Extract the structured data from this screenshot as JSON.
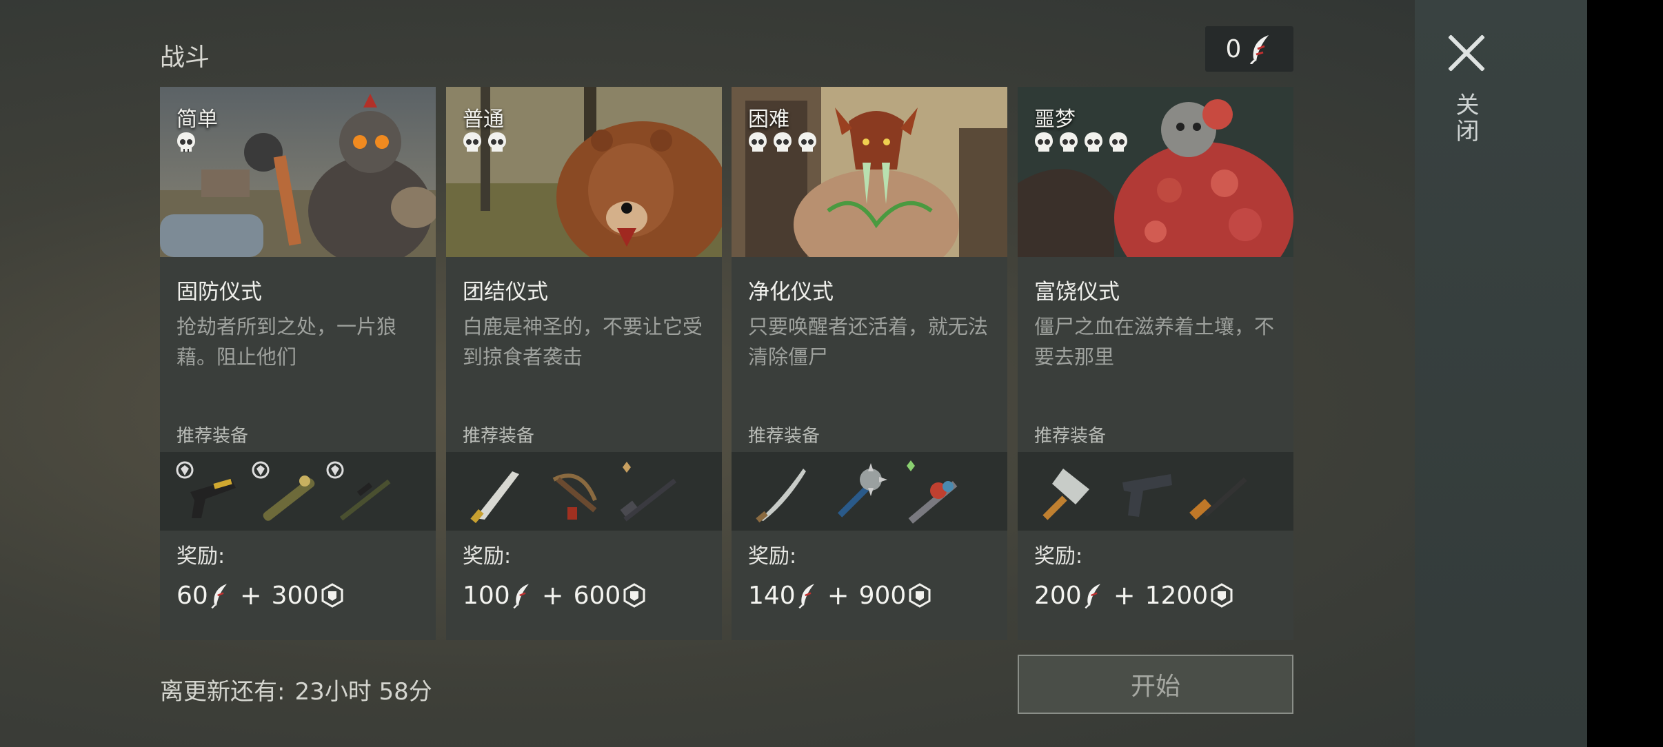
{
  "header": {
    "title": "战斗",
    "currency_value": "0",
    "currency_icon": "feather-icon"
  },
  "side": {
    "close_label": "关闭"
  },
  "cards": [
    {
      "difficulty": "简单",
      "skulls": 1,
      "ritual": "固防仪式",
      "description": "抢劫者所到之处，一片狼藉。阻止他们",
      "recommended_label": "推荐装备",
      "gear": [
        "pistol-icon",
        "rocket-launcher-icon",
        "sniper-rifle-icon"
      ],
      "reward_label": "奖励:",
      "reward_feathers": "60",
      "reward_plus": "+",
      "reward_coins": "300"
    },
    {
      "difficulty": "普通",
      "skulls": 2,
      "ritual": "团结仪式",
      "description": "白鹿是神圣的，不要让它受到掠食者袭击",
      "recommended_label": "推荐装备",
      "gear": [
        "machete-icon",
        "crossbow-icon",
        "hunting-rifle-icon"
      ],
      "reward_label": "奖励:",
      "reward_feathers": "100",
      "reward_plus": "+",
      "reward_coins": "600"
    },
    {
      "difficulty": "困难",
      "skulls": 3,
      "ritual": "净化仪式",
      "description": "只要唤醒者还活着，就无法清除僵尸",
      "recommended_label": "推荐装备",
      "gear": [
        "katana-icon",
        "spiked-mace-icon",
        "flamethrower-icon"
      ],
      "reward_label": "奖励:",
      "reward_feathers": "140",
      "reward_plus": "+",
      "reward_coins": "900"
    },
    {
      "difficulty": "噩梦",
      "skulls": 4,
      "ritual": "富饶仪式",
      "description": "僵尸之血在滋养着土壤，不要去那里",
      "recommended_label": "推荐装备",
      "gear": [
        "cleaver-icon",
        "handgun-icon",
        "shotgun-icon"
      ],
      "reward_label": "奖励:",
      "reward_feathers": "200",
      "reward_plus": "+",
      "reward_coins": "1200"
    }
  ],
  "footer": {
    "timer_label": "离更新还有:",
    "timer_value": "23小时 58分",
    "start_label": "开始"
  },
  "colors": {
    "card_bg": "#3a3e3b",
    "equip_bg": "#2c302e",
    "side_panel": "#394241"
  }
}
